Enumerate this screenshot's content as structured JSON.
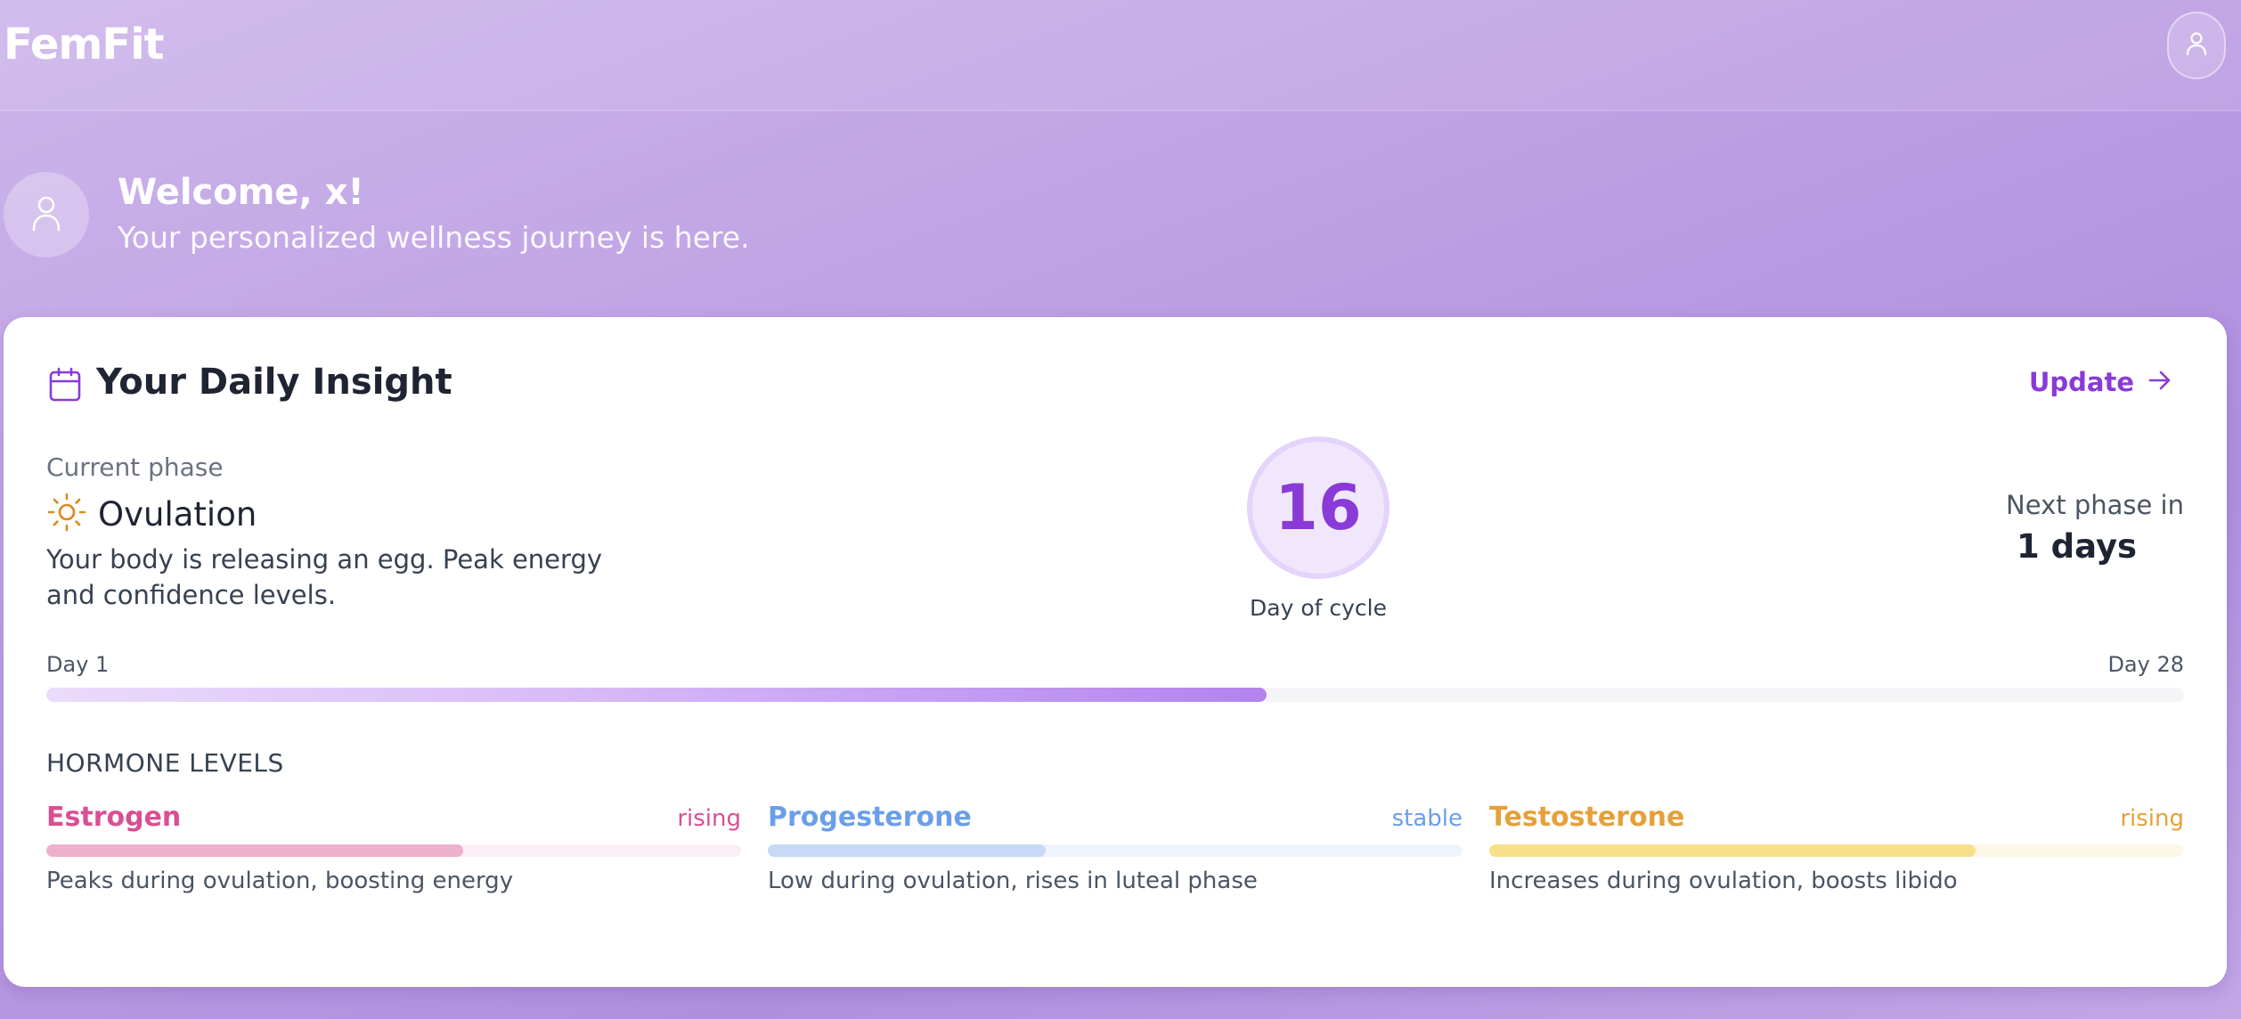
{
  "app": {
    "logo": "FemFit"
  },
  "welcome": {
    "title": "Welcome, x!",
    "subtitle": "Your personalized wellness journey is here."
  },
  "insight": {
    "title": "Your Daily Insight",
    "update_label": "Update",
    "phase_label": "Current phase",
    "phase_name": "Ovulation",
    "phase_description": "Your body is releasing an egg. Peak energy and confidence levels.",
    "day_number": "16",
    "day_label": "Day of cycle",
    "next_phase_label": "Next phase in",
    "next_phase_value": "1 days",
    "cycle_start_label": "Day 1",
    "cycle_end_label": "Day 28",
    "cycle_progress": 0.571
  },
  "hormones": {
    "heading": "HORMONE LEVELS",
    "items": [
      {
        "name": "Estrogen",
        "trend": "rising",
        "level": 0.6,
        "description": "Peaks during ovulation, boosting energy",
        "color": "#d94f93",
        "track_color": "#fbeef4",
        "fill_color": "#eeb0cc"
      },
      {
        "name": "Progesterone",
        "trend": "stable",
        "level": 0.4,
        "description": "Low during ovulation, rises in luteal phase",
        "color": "#6a9fe8",
        "track_color": "#eef4fd",
        "fill_color": "#c6daf8"
      },
      {
        "name": "Testosterone",
        "trend": "rising",
        "level": 0.7,
        "description": "Increases during ovulation, boosts libido",
        "color": "#e4a13a",
        "track_color": "#fdf8e6",
        "fill_color": "#f8e08a"
      }
    ]
  },
  "icons": {
    "profile": "user-icon",
    "calendar": "calendar-icon",
    "arrow": "arrow-right-icon",
    "sun": "sun-icon"
  },
  "colors": {
    "accent": "#8a3ad6",
    "sun": "#d98a1e"
  }
}
